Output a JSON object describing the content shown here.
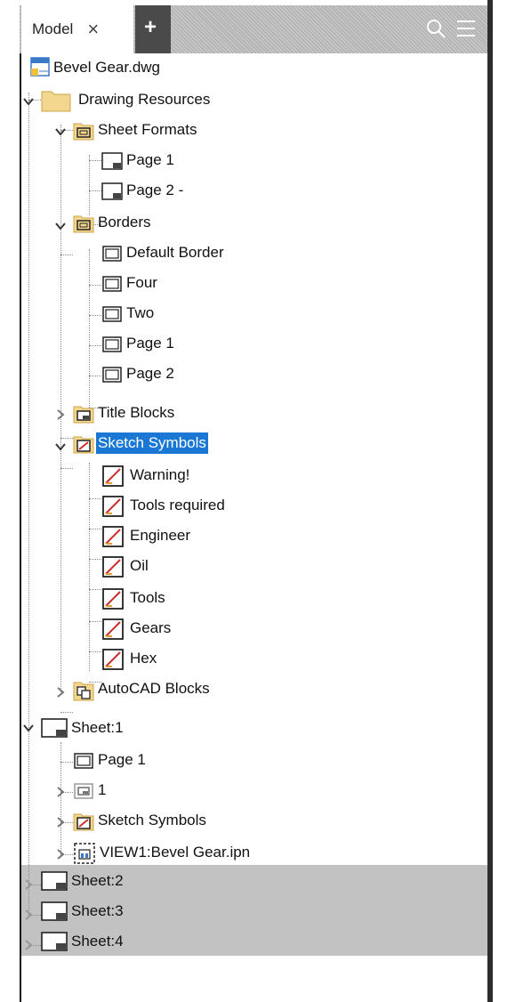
{
  "header": {
    "tab_label": "Model",
    "close_glyph": "×",
    "add_glyph": "+",
    "search_icon": "search-icon",
    "menu_icon": "menu-icon"
  },
  "colors": {
    "selection": "#1a78d4",
    "header_bg": "#b4b4b4",
    "gray_rows": "#c2c2c2",
    "folder": "#f4d78e"
  },
  "tree": {
    "root": "Bevel Gear.dwg",
    "drawing_resources": "Drawing Resources",
    "sheet_formats": "Sheet Formats",
    "sheet_formats_items": [
      "Page 1",
      "Page 2 -"
    ],
    "borders": "Borders",
    "borders_items": [
      "Default Border",
      "Four",
      "Two",
      "Page 1",
      "Page 2"
    ],
    "title_blocks": "Title Blocks",
    "sketch_symbols": "Sketch Symbols",
    "sketch_symbols_items": [
      "Warning!",
      "Tools required",
      "Engineer",
      "Oil",
      "Tools",
      "Gears",
      "Hex"
    ],
    "autocad_blocks": "AutoCAD Blocks",
    "sheet1": "Sheet:1",
    "sheet1_items": {
      "border": "Page 1",
      "title_block": "1",
      "sketch_symbols": "Sketch Symbols",
      "view": "VIEW1:Bevel Gear.ipn"
    },
    "other_sheets": [
      "Sheet:2",
      "Sheet:3",
      "Sheet:4"
    ]
  }
}
